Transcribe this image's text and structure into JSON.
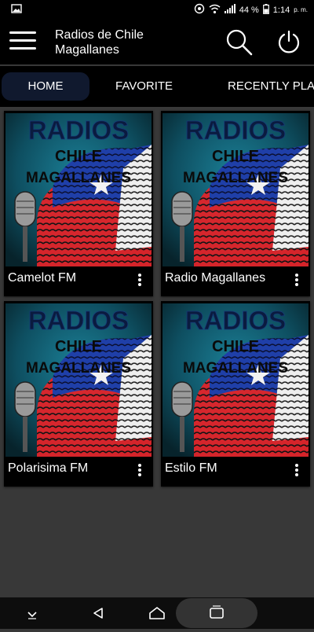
{
  "status": {
    "battery_percent": "44 %",
    "time": "1:14",
    "ampm": "p. m."
  },
  "appbar": {
    "title": "Radios de Chile Magallanes",
    "menu_icon": "hamburger-icon",
    "search_icon": "search-icon",
    "power_icon": "power-icon"
  },
  "tabs": [
    {
      "label": "HOME",
      "active": true
    },
    {
      "label": "FAVORITE",
      "active": false
    },
    {
      "label": "RECENTLY PLAYED",
      "active": false
    }
  ],
  "thumbnail": {
    "line1": "RADIOS",
    "line2": "CHILE",
    "line3": "MAGALLANES"
  },
  "stations": [
    {
      "name": "Camelot FM"
    },
    {
      "name": "Radio Magallanes"
    },
    {
      "name": "Polarisima FM"
    },
    {
      "name": "Estilo FM"
    }
  ],
  "colors": {
    "accent_tab": "#10192e",
    "chile_blue": "#1f3fa8",
    "chile_red": "#e0242a",
    "chile_white": "#f2f2f2",
    "thumb_bg": "#0f5b6e"
  }
}
